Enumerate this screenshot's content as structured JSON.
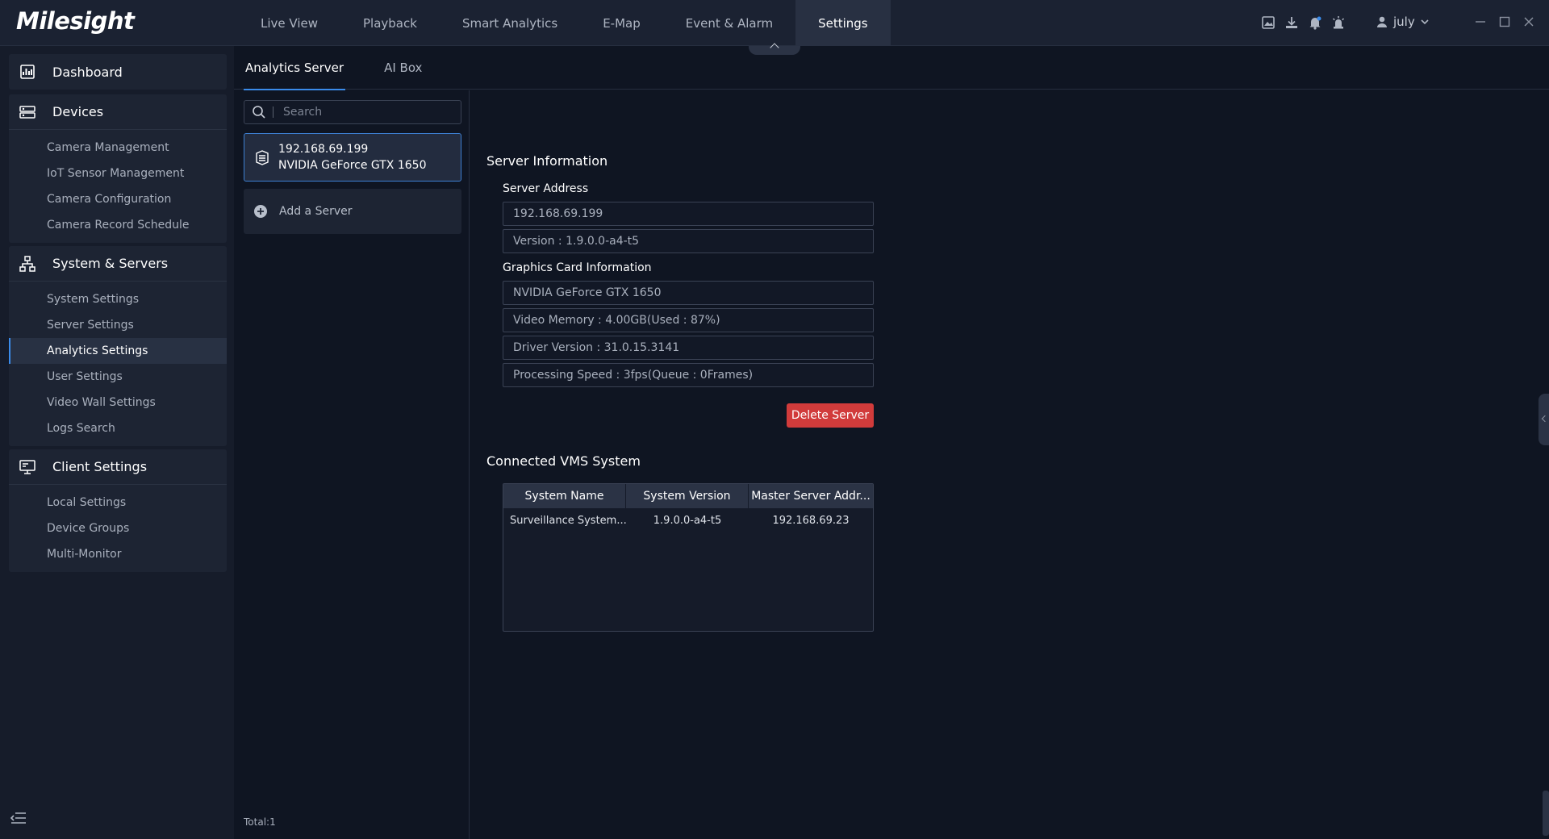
{
  "app": {
    "logo": "Milesight"
  },
  "nav": {
    "items": [
      "Live View",
      "Playback",
      "Smart Analytics",
      "E-Map",
      "Event & Alarm",
      "Settings"
    ],
    "active": "Settings"
  },
  "user": {
    "name": "july"
  },
  "sidebar": {
    "dashboard": "Dashboard",
    "devices": {
      "label": "Devices",
      "items": [
        "Camera Management",
        "IoT Sensor Management",
        "Camera Configuration",
        "Camera Record Schedule"
      ]
    },
    "system": {
      "label": "System & Servers",
      "items": [
        "System Settings",
        "Server Settings",
        "Analytics Settings",
        "User Settings",
        "Video Wall Settings",
        "Logs Search"
      ],
      "active": "Analytics Settings"
    },
    "client": {
      "label": "Client Settings",
      "items": [
        "Local Settings",
        "Device Groups",
        "Multi-Monitor"
      ]
    }
  },
  "tabs": {
    "analytics_server": "Analytics Server",
    "ai_box": "AI Box"
  },
  "server_list": {
    "search_placeholder": "Search",
    "selected": {
      "ip": "192.168.69.199",
      "gpu": "NVIDIA GeForce GTX 1650"
    },
    "add_label": "Add a Server",
    "total": "Total:1"
  },
  "server_info": {
    "title": "Server Information",
    "address_label": "Server Address",
    "address": "192.168.69.199",
    "version": "Version : 1.9.0.0-a4-t5",
    "gpu_label": "Graphics Card Information",
    "gpu_name": "NVIDIA GeForce GTX 1650",
    "video_memory": "Video Memory : 4.00GB(Used : 87%)",
    "driver_version": "Driver Version : 31.0.15.3141",
    "processing_speed": "Processing Speed : 3fps(Queue : 0Frames)",
    "delete_label": "Delete Server"
  },
  "vms": {
    "title": "Connected VMS System",
    "columns": [
      "System Name",
      "System Version",
      "Master Server Addr..."
    ],
    "rows": [
      [
        "Surveillance System...",
        "1.9.0.0-a4-t5",
        "192.168.69.23"
      ]
    ]
  },
  "colors": {
    "accent": "#3a8bea",
    "danger": "#d13b3b",
    "topbar": "#1b2232",
    "background": "#0f1522"
  }
}
